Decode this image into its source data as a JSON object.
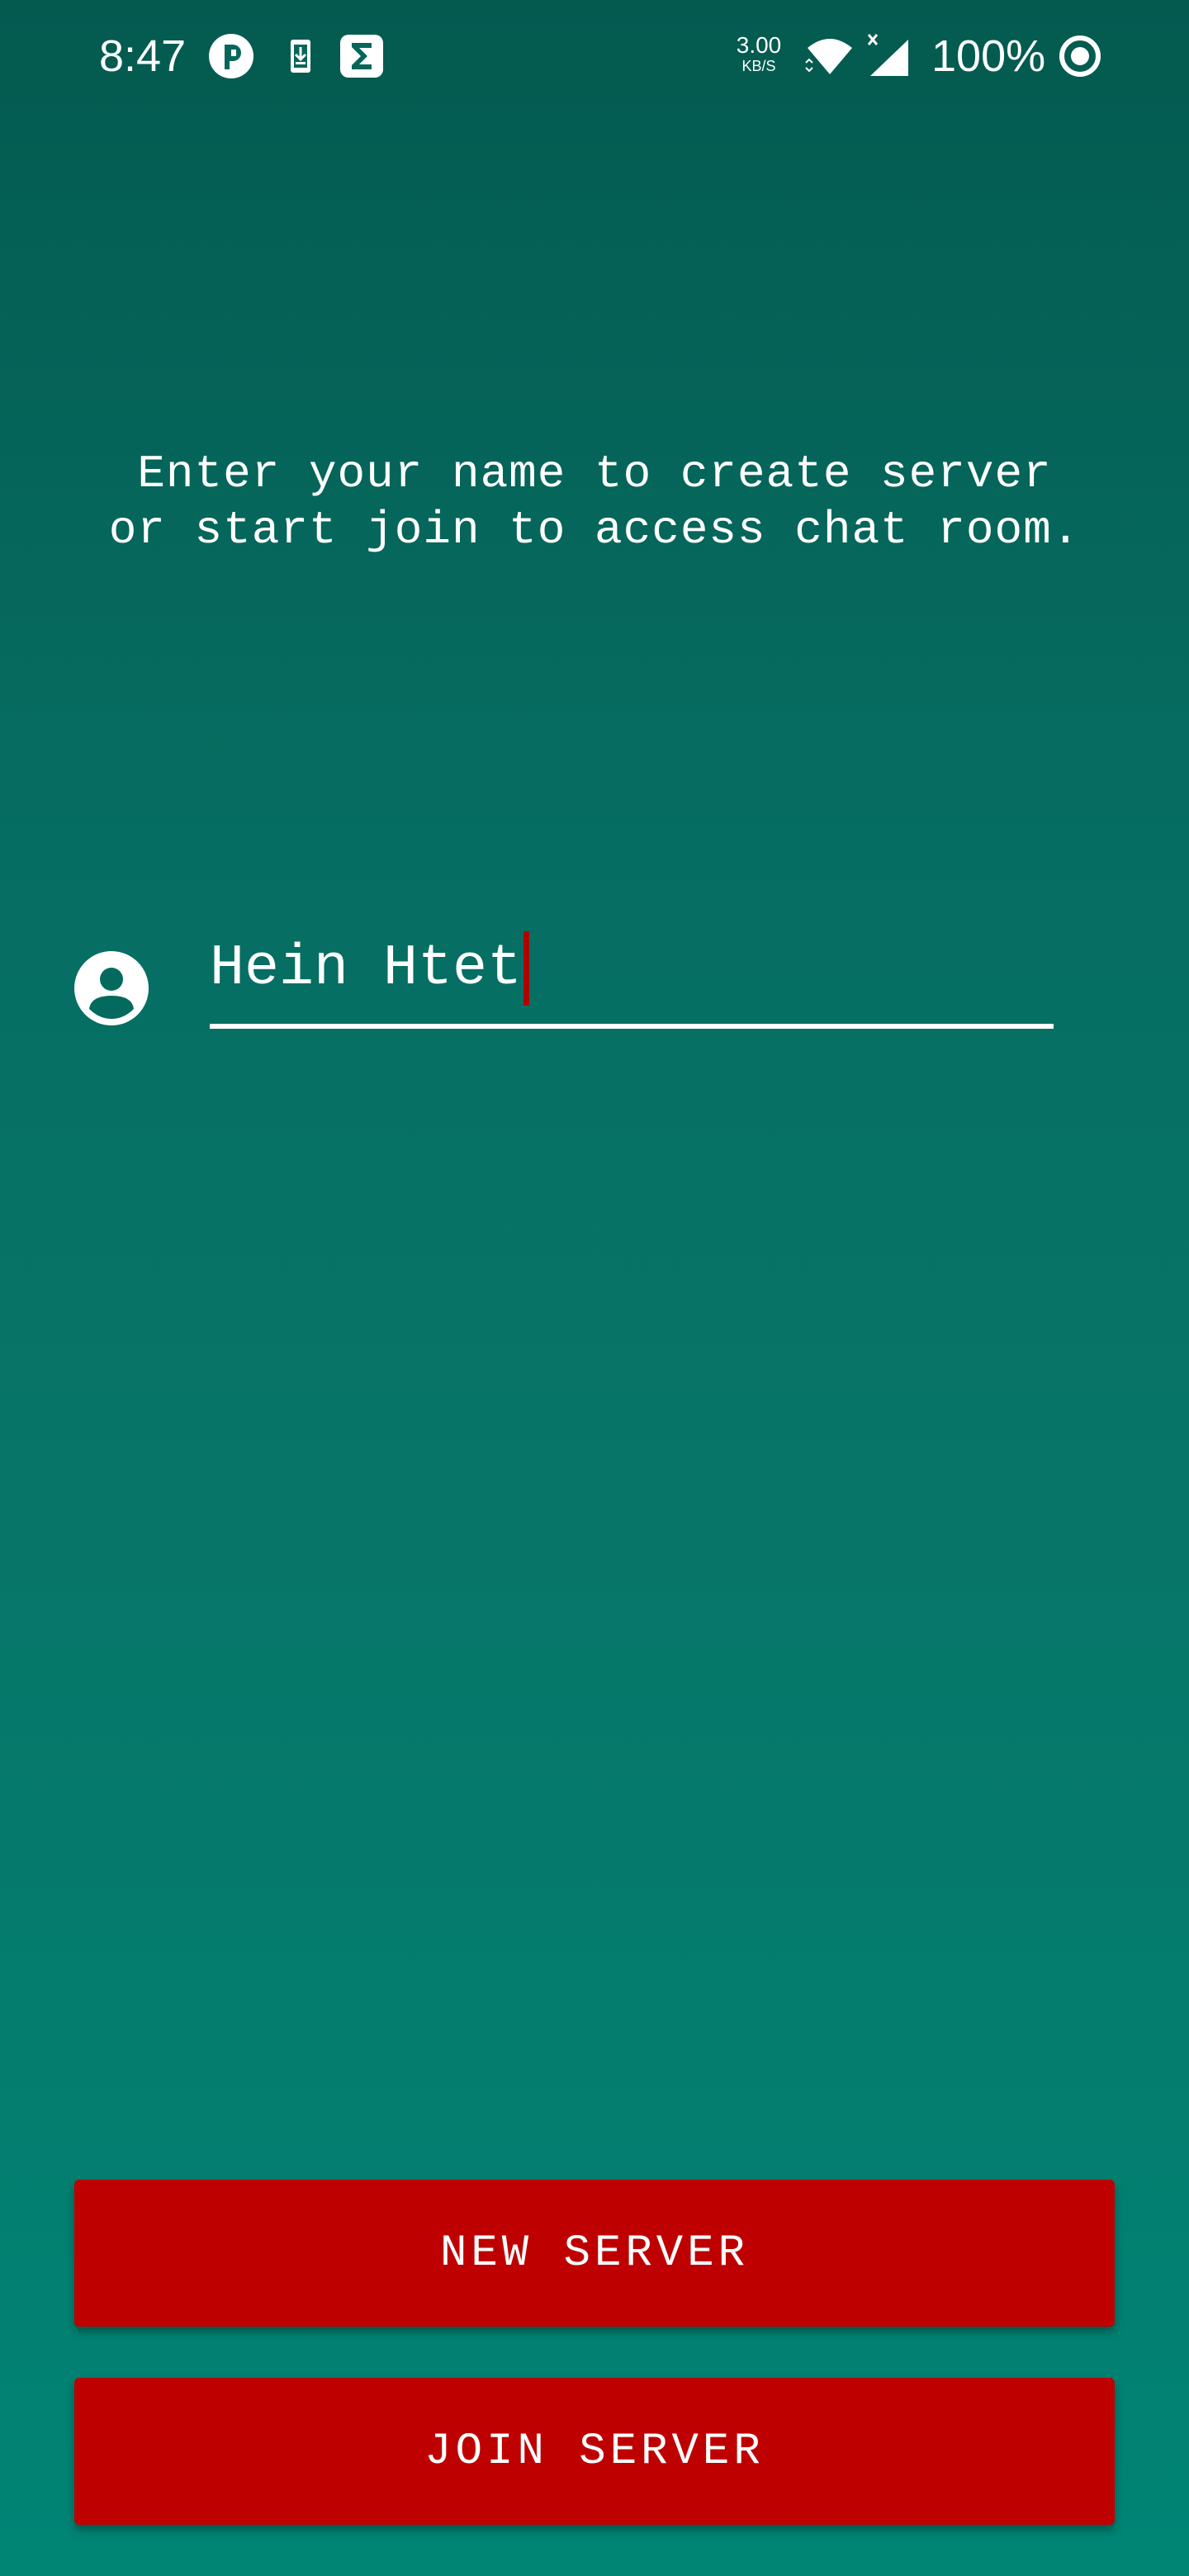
{
  "status_bar": {
    "time": "8:47",
    "left_icons": [
      "app-badge-icon",
      "download-icon",
      "sigma-app-icon"
    ],
    "net_speed_value": "3.00",
    "net_speed_unit": "KB/S",
    "right_icons": [
      "wifi-icon",
      "cellular-signal-icon",
      "battery-ring-icon"
    ],
    "battery": "100%"
  },
  "main": {
    "instructions": "Enter your name to create server or start join to access chat room.",
    "name_field": {
      "icon": "account-circle-icon",
      "value": "Hein Htet"
    }
  },
  "actions": {
    "new_server_label": "NEW SERVER",
    "join_server_label": "JOIN SERVER"
  },
  "colors": {
    "background_top": "#045a4f",
    "background_bottom": "#008474",
    "button": "#be0000",
    "caret": "#b00000",
    "text": "#ffffff"
  }
}
